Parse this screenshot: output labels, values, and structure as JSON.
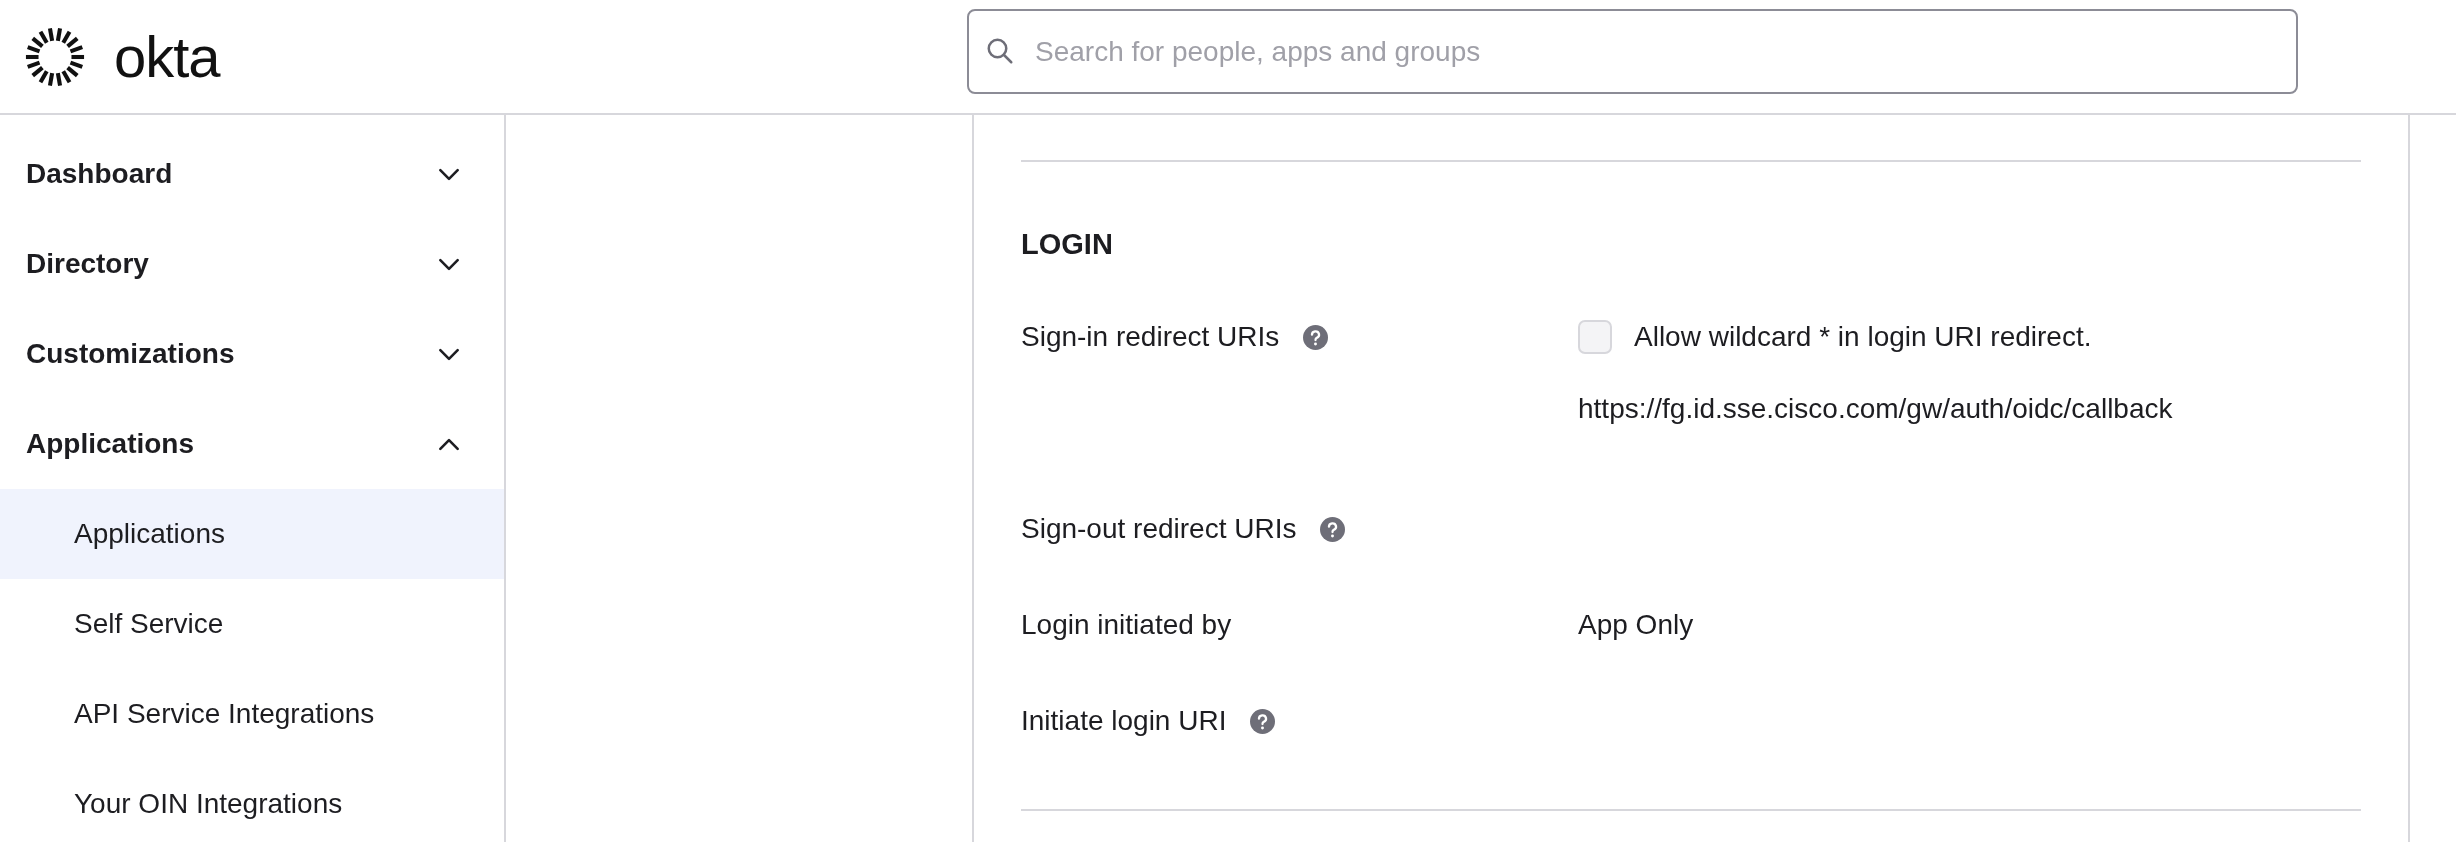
{
  "header": {
    "logo_text": "okta",
    "search": {
      "placeholder": "Search for people, apps and groups"
    }
  },
  "sidebar": {
    "items": [
      {
        "label": "Dashboard",
        "expanded": false
      },
      {
        "label": "Directory",
        "expanded": false
      },
      {
        "label": "Customizations",
        "expanded": false
      },
      {
        "label": "Applications",
        "expanded": true,
        "children": [
          {
            "label": "Applications",
            "selected": true
          },
          {
            "label": "Self Service",
            "selected": false
          },
          {
            "label": "API Service Integrations",
            "selected": false
          },
          {
            "label": "Your OIN Integrations",
            "selected": false
          }
        ]
      }
    ]
  },
  "section": {
    "title": "LOGIN",
    "rows": [
      {
        "label": "Sign-in redirect URIs",
        "help": true,
        "checkbox": {
          "label": "Allow wildcard * in login URI redirect.",
          "checked": false
        },
        "values": [
          "https://fg.id.sse.cisco.com/gw/auth/oidc/callback"
        ]
      },
      {
        "label": "Sign-out redirect URIs",
        "help": true
      },
      {
        "label": "Login initiated by",
        "help": false,
        "values": [
          "App Only"
        ]
      },
      {
        "label": "Initiate login URI",
        "help": true
      }
    ]
  }
}
